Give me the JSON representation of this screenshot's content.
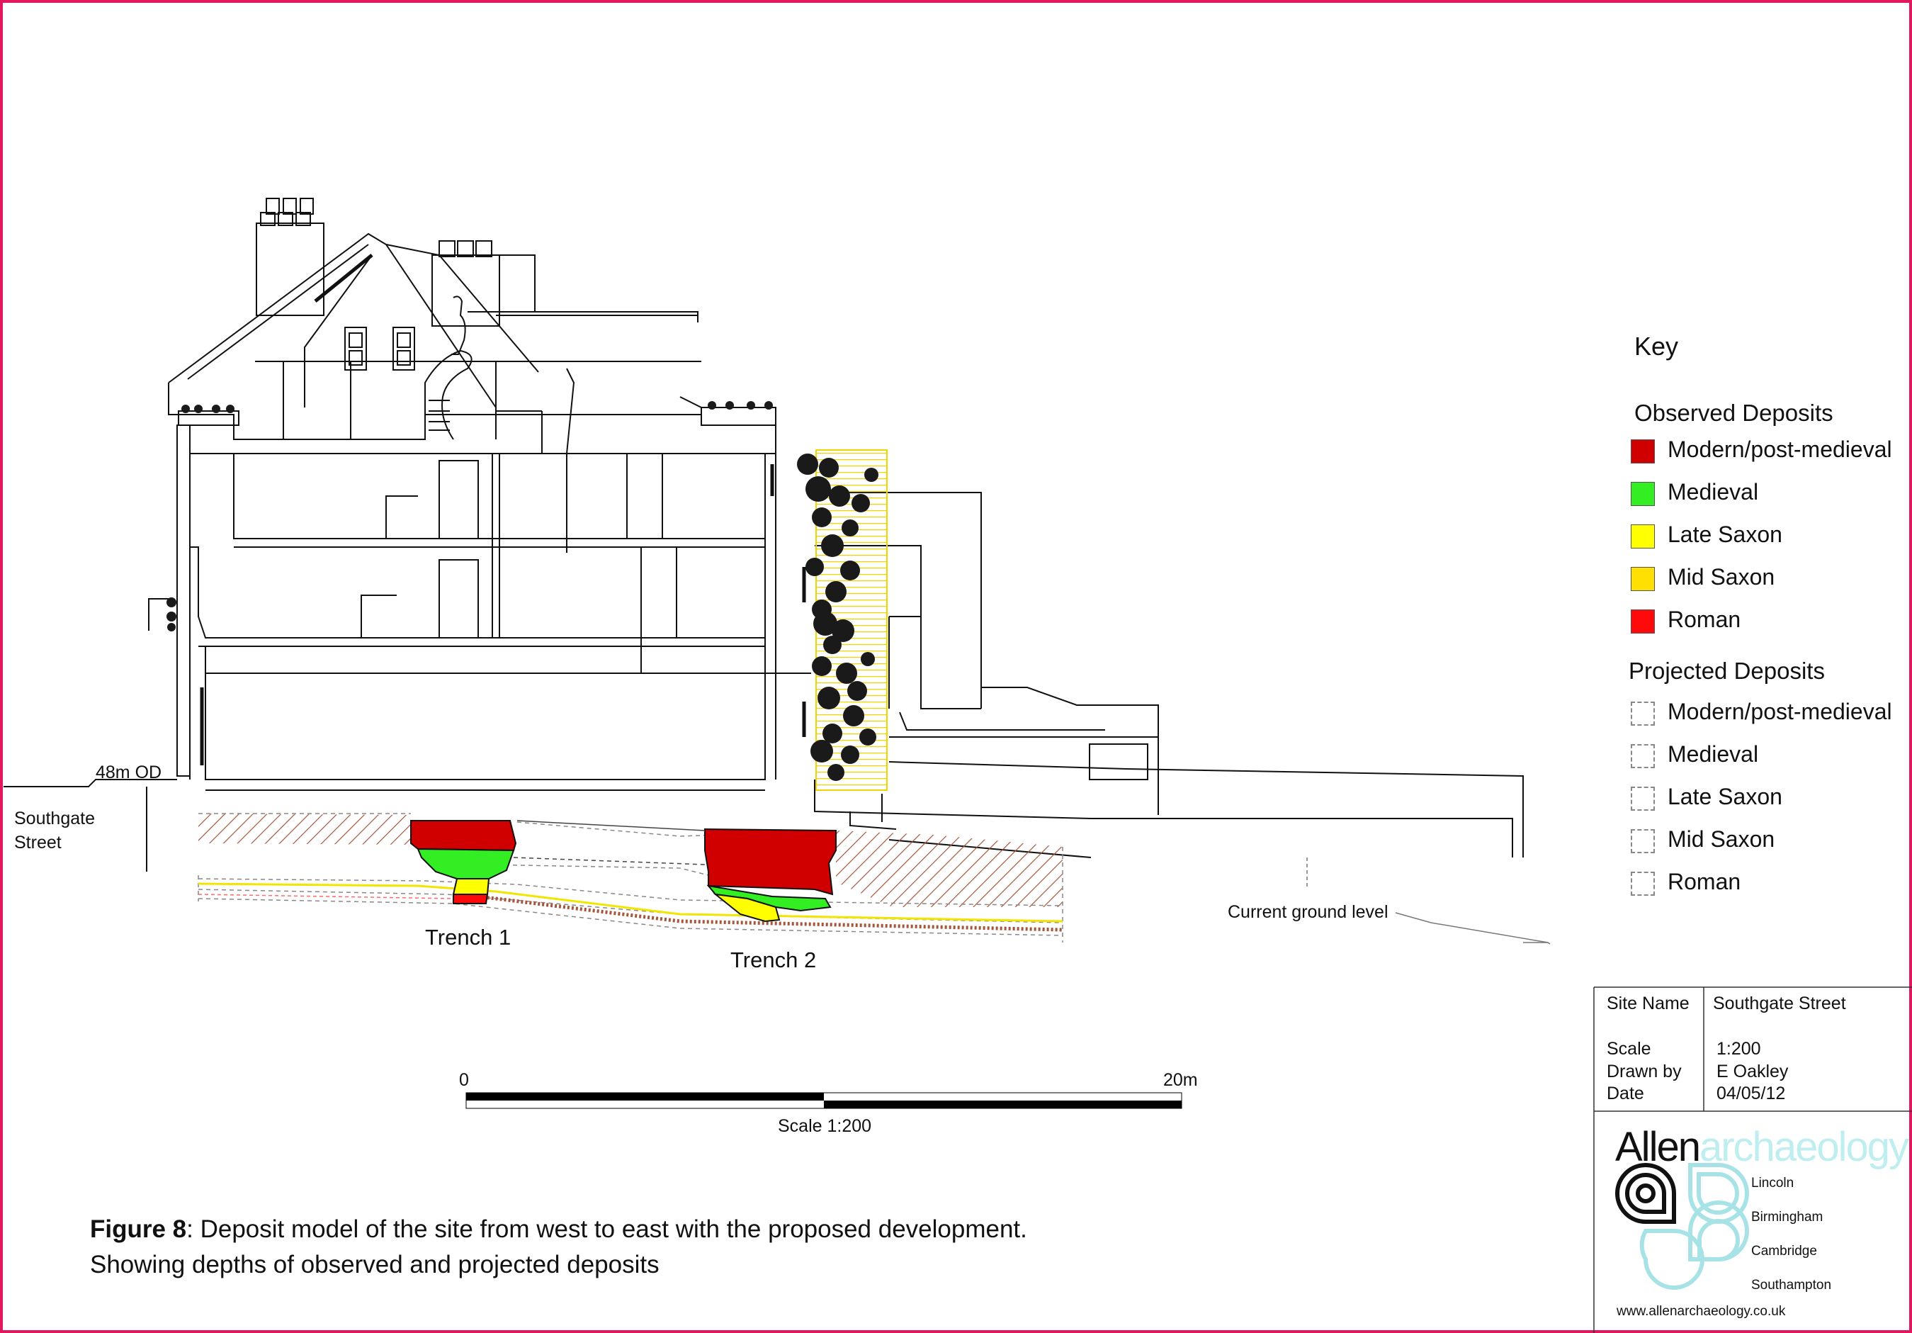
{
  "drawing": {
    "datum_label": "48m OD",
    "street_label_line1": "Southgate",
    "street_label_line2": "Street",
    "trench1_label": "Trench 1",
    "trench2_label": "Trench 2",
    "ground_level_label": "Current ground level"
  },
  "scale_bar": {
    "start_label": "0",
    "end_label": "20m",
    "caption": "Scale 1:200"
  },
  "key": {
    "title": "Key",
    "observed_heading": "Observed Deposits",
    "observed": [
      {
        "label": "Modern/post-medieval",
        "color": "#d00000"
      },
      {
        "label": "Medieval",
        "color": "#33ee22"
      },
      {
        "label": "Late Saxon",
        "color": "#ffff00"
      },
      {
        "label": "Mid Saxon",
        "color": "#ffe000"
      },
      {
        "label": "Roman",
        "color": "#ff0a0a"
      }
    ],
    "projected_heading": "Projected Deposits",
    "projected": [
      {
        "label": "Modern/post-medieval"
      },
      {
        "label": "Medieval"
      },
      {
        "label": "Late Saxon"
      },
      {
        "label": "Mid Saxon"
      },
      {
        "label": "Roman"
      }
    ]
  },
  "title_block": {
    "site_name_label": "Site Name",
    "site_name_value": "Southgate Street",
    "scale_label": "Scale",
    "scale_value": "1:200",
    "drawn_by_label": "Drawn by",
    "drawn_by_value": "E Oakley",
    "date_label": "Date",
    "date_value": "04/05/12"
  },
  "logo": {
    "word_dark": "Allen",
    "word_light": "archaeology",
    "offices": [
      "Lincoln",
      "Birmingham",
      "Cambridge",
      "Southampton"
    ],
    "url": "www.allenarchaeology.co.uk"
  },
  "caption": {
    "figure_label": "Figure 8",
    "line1_rest": ": Deposit model of the site from west to east with the proposed development.",
    "line2": "Showing depths of observed and projected deposits"
  },
  "colors": {
    "border": "#e2185f",
    "modern": "#d00000",
    "medieval": "#33ee22",
    "late_saxon": "#ffff00",
    "mid_saxon": "#ffe000",
    "roman": "#ff0a0a",
    "hatch": "#a5563a",
    "logo_light": "#bfeef0",
    "foliage_frame": "#f2d500"
  }
}
